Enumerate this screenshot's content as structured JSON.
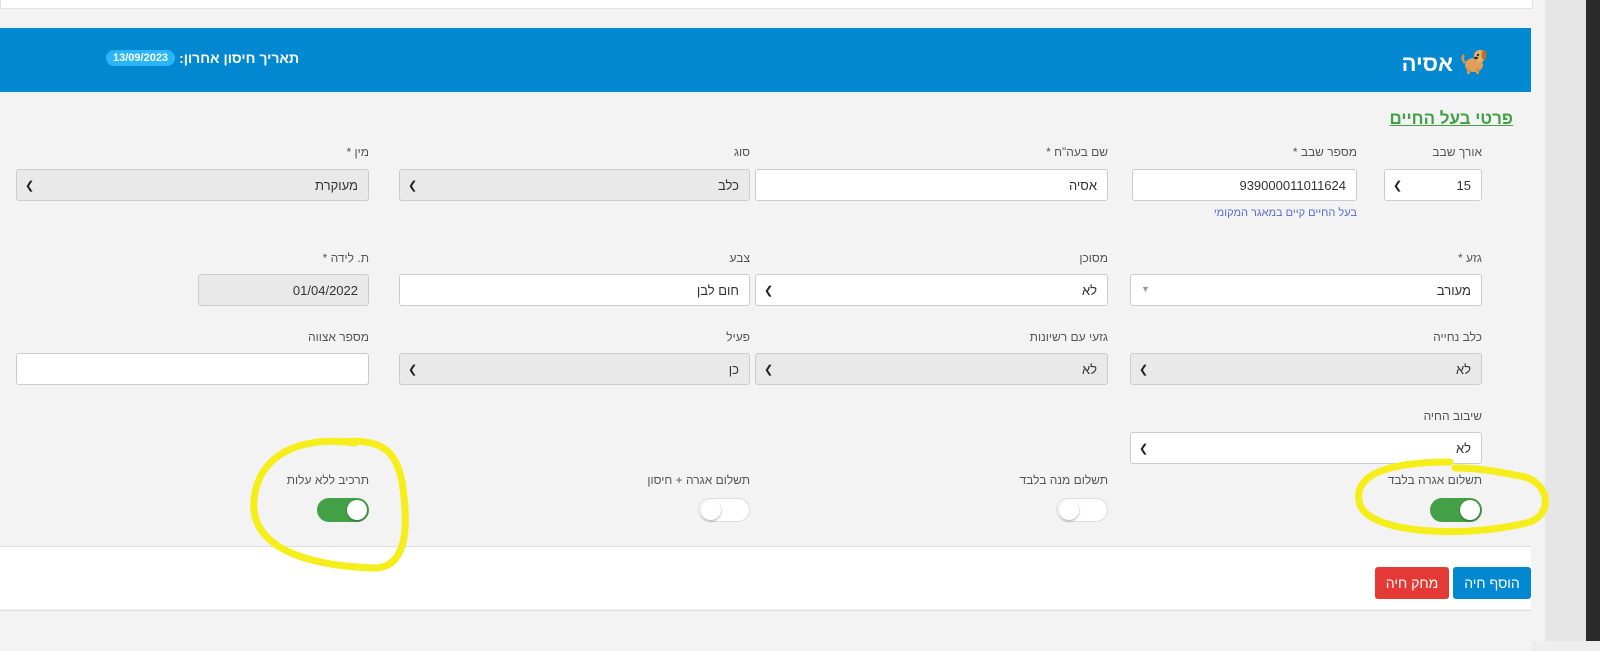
{
  "header": {
    "pet_name": "אסיה",
    "last_vaccine_label": "תאריך חיסון אחרון:",
    "last_vaccine_date": "13/09/2023",
    "pet_icon": "dog-icon"
  },
  "section_title": "פרטי בעל החיים",
  "fields": {
    "chip_length": {
      "label": "אורך שבב",
      "value": "15"
    },
    "chip_number": {
      "label": "מספר שבב *",
      "value": "939000011011624",
      "hint": "בעל החיים קיים במאגר המקומי"
    },
    "pet_name": {
      "label": "שם בעה\"ח *",
      "value": "אסיה"
    },
    "type": {
      "label": "סוג",
      "value": "כלב"
    },
    "sex": {
      "label": "מין *",
      "value": "מעוקרת"
    },
    "breed": {
      "label": "גזע *",
      "value": "מעורב"
    },
    "dangerous": {
      "label": "מסוכן",
      "value": "לא"
    },
    "color": {
      "label": "צבע",
      "value": "חום לבן"
    },
    "birth_date": {
      "label": "ת. לידה *",
      "value": "01/04/2022"
    },
    "guide_dog": {
      "label": "כלב נחייה",
      "value": "לא"
    },
    "licensed_breed": {
      "label": "גזעי עם רשיונות",
      "value": "לא"
    },
    "active": {
      "label": "פעיל",
      "value": "כן"
    },
    "order_number": {
      "label": "מספר אצווה",
      "value": ""
    },
    "chipping": {
      "label": "שיבוב החיה",
      "value": "לא"
    }
  },
  "toggles": {
    "fee_only": {
      "label": "תשלום אגרה בלבד",
      "on": true
    },
    "dose_only": {
      "label": "תשלום מנה בלבד",
      "on": false
    },
    "fee_and_vaccine": {
      "label": "תשלום אגרה + חיסון",
      "on": false
    },
    "no_cost_component": {
      "label": "תרכיב ללא עלות",
      "on": true
    }
  },
  "buttons": {
    "add_pet": "הוסף חיה",
    "delete_pet": "מחק חיה"
  },
  "colors": {
    "header_bg": "#0288d1",
    "toggle_on": "#43a047",
    "add_button": "#0288d1",
    "delete_button": "#e53935",
    "annotation": "#f5ee1b"
  }
}
